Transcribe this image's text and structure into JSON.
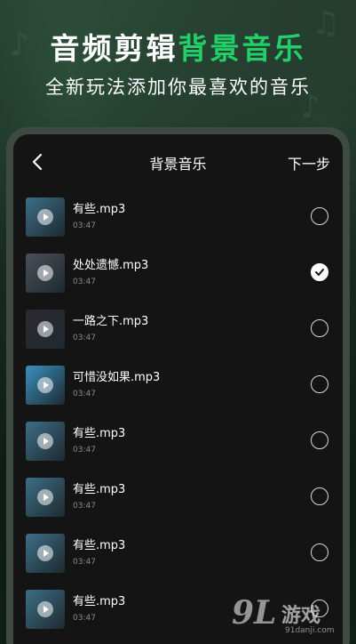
{
  "headline": {
    "part1": "音频剪辑",
    "part2": "背景音乐"
  },
  "subtitle": "全新玩法添加你最喜欢的音乐",
  "nav": {
    "back_icon": "chevron-left-icon",
    "title": "背景音乐",
    "next_label": "下一步"
  },
  "songs": [
    {
      "name": "有些.mp3",
      "duration": "03:47",
      "selected": false,
      "thumb": "#3c6e86"
    },
    {
      "name": "处处遗憾.mp3",
      "duration": "03:47",
      "selected": true,
      "thumb": "#4a5058"
    },
    {
      "name": "一路之下.mp3",
      "duration": "03:47",
      "selected": false,
      "thumb": "#2c2a30"
    },
    {
      "name": "可惜没如果.mp3",
      "duration": "03:47",
      "selected": false,
      "thumb": "#3a90c0"
    },
    {
      "name": "有些.mp3",
      "duration": "03:47",
      "selected": false,
      "thumb": "#3c6e86"
    },
    {
      "name": "有些.mp3",
      "duration": "03:47",
      "selected": false,
      "thumb": "#3c6e86"
    },
    {
      "name": "有些.mp3",
      "duration": "03:47",
      "selected": false,
      "thumb": "#3c6e86"
    },
    {
      "name": "有些.mp3",
      "duration": "03:47",
      "selected": false,
      "thumb": "#3c6e86"
    }
  ],
  "watermark": {
    "logo": "9L",
    "text": "游戏",
    "url": "91danji.com"
  },
  "colors": {
    "accent": "#22d06a",
    "background": "#141414",
    "frame": "#3f4a43"
  }
}
